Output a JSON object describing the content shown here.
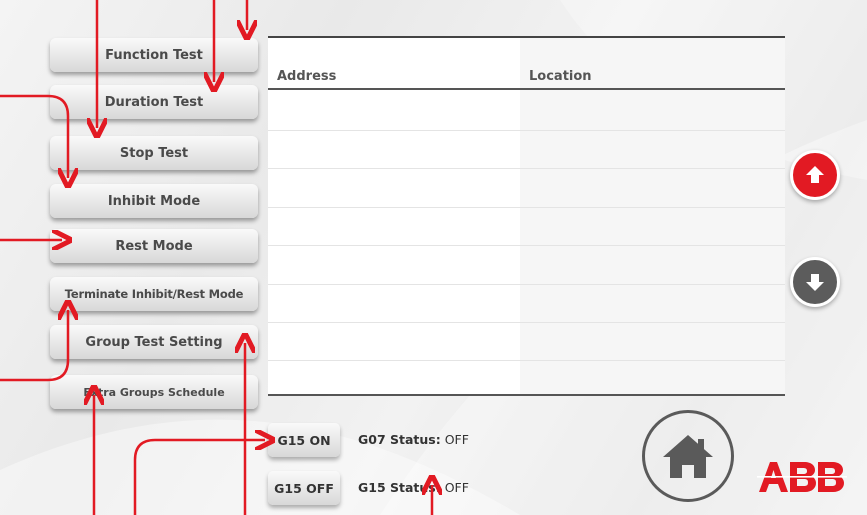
{
  "menu": {
    "function_test": "Function Test",
    "duration_test": "Duration Test",
    "stop_test": "Stop Test",
    "inhibit_mode": "Inhibit Mode",
    "rest_mode": "Rest Mode",
    "terminate": "Terminate Inhibit/Rest Mode",
    "group_test_setting": "Group Test Setting",
    "extra_groups_schedule": "Extra Groups Schedule"
  },
  "table": {
    "columns": [
      "Address",
      "Location"
    ],
    "rows": []
  },
  "groups": {
    "on_label": "G15 ON",
    "off_label": "G15 OFF",
    "status1_label": "G07 Status:",
    "status1_value": "OFF",
    "status2_label": "G15 Status:",
    "status2_value": "OFF"
  },
  "brand": {
    "logo": "ABB",
    "accent": "#e21a23"
  },
  "icons": {
    "scroll_up": "arrow-up-circle-icon",
    "scroll_down": "arrow-down-circle-icon",
    "home": "home-icon"
  }
}
